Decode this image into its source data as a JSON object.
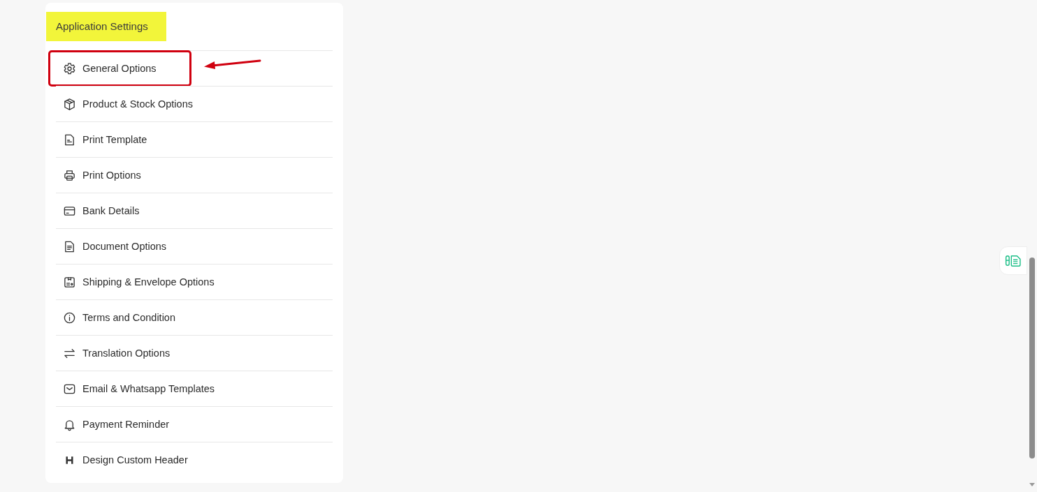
{
  "panel": {
    "title": "Application Settings",
    "items": [
      {
        "label": "General Options",
        "kind": "gear",
        "highlighted": true
      },
      {
        "label": "Product & Stock Options",
        "kind": "box",
        "highlighted": false
      },
      {
        "label": "Print Template",
        "kind": "template",
        "highlighted": false
      },
      {
        "label": "Print Options",
        "kind": "printer",
        "highlighted": false
      },
      {
        "label": "Bank Details",
        "kind": "card",
        "highlighted": false
      },
      {
        "label": "Document Options",
        "kind": "document",
        "highlighted": false
      },
      {
        "label": "Shipping & Envelope Options",
        "kind": "shipping",
        "highlighted": false
      },
      {
        "label": "Terms and Condition",
        "kind": "info",
        "highlighted": false
      },
      {
        "label": "Translation Options",
        "kind": "swap",
        "highlighted": false
      },
      {
        "label": "Email & Whatsapp Templates",
        "kind": "mail",
        "highlighted": false
      },
      {
        "label": "Payment Reminder",
        "kind": "bell",
        "highlighted": false
      },
      {
        "label": "Design Custom Header",
        "kind": "heading",
        "highlighted": false
      }
    ]
  }
}
